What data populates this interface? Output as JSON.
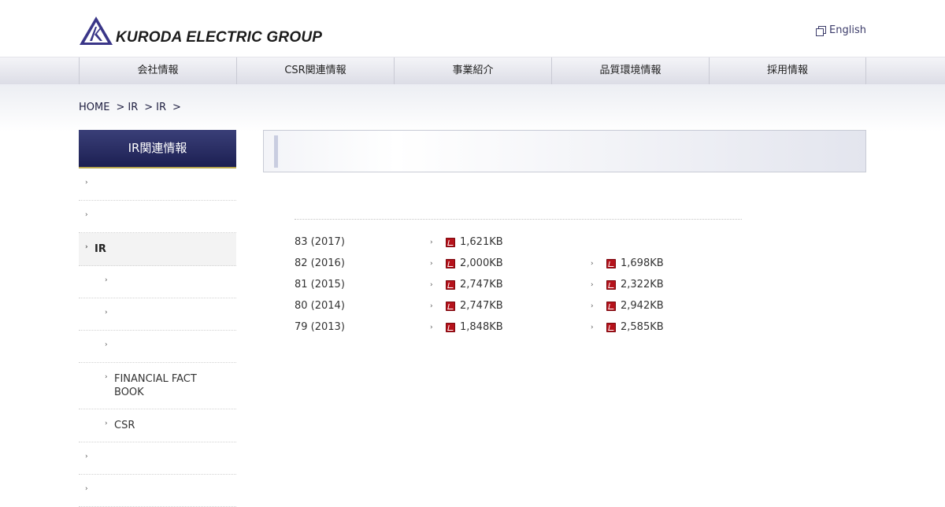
{
  "header": {
    "logo_text": "KURODA ELECTRIC GROUP",
    "lang_label": "English"
  },
  "global_nav": [
    {
      "label": "会社情報"
    },
    {
      "label": "CSR関連情報"
    },
    {
      "label": "事業紹介"
    },
    {
      "label": "品質環境情報"
    },
    {
      "label": "採用情報"
    }
  ],
  "breadcrumb": {
    "home": "HOME",
    "sep": ">",
    "level1": "IR",
    "level2": "IR",
    "tail_sep": ">"
  },
  "sidebar": {
    "title": "IR関連情報",
    "items": [
      {
        "label": "",
        "level": 1,
        "active": false
      },
      {
        "label": "",
        "level": 1,
        "active": false
      },
      {
        "label": "IR",
        "level": 1,
        "active": true
      },
      {
        "label": "",
        "level": 2,
        "active": false
      },
      {
        "label": "",
        "level": 2,
        "active": false
      },
      {
        "label": "",
        "level": 2,
        "active": false
      },
      {
        "label": "FINANCIAL FACT BOOK",
        "level": 2,
        "active": false
      },
      {
        "label": "CSR",
        "level": 2,
        "active": false
      },
      {
        "label": "",
        "level": 1,
        "active": false
      },
      {
        "label": "",
        "level": 1,
        "active": false
      }
    ]
  },
  "reports": [
    {
      "year": "83 (2017)",
      "col1": "1,621KB",
      "col2": ""
    },
    {
      "year": "82 (2016)",
      "col1": "2,000KB",
      "col2": "1,698KB"
    },
    {
      "year": "81 (2015)",
      "col1": "2,747KB",
      "col2": "2,322KB"
    },
    {
      "year": "80 (2014)",
      "col1": "2,747KB",
      "col2": "2,942KB"
    },
    {
      "year": "79 (2013)",
      "col1": "1,848KB",
      "col2": "2,585KB"
    }
  ],
  "icons": {
    "arrow": "›",
    "pdf": "pdf-icon",
    "globe": "language-icon"
  },
  "colors": {
    "sidebar_header": "#1c1f52",
    "sidebar_border": "#b7a64e",
    "pdf_red": "#b5121b",
    "link_navy": "#1e1e40"
  }
}
